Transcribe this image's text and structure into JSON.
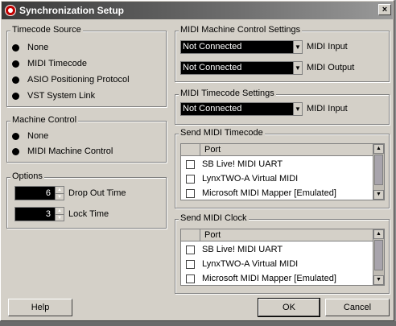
{
  "window": {
    "title": "Synchronization Setup",
    "close_glyph": "×"
  },
  "timecode_source": {
    "legend": "Timecode Source",
    "options": [
      "None",
      "MIDI Timecode",
      "ASIO Positioning Protocol",
      "VST System Link"
    ]
  },
  "machine_control": {
    "legend": "Machine Control",
    "options": [
      "None",
      "MIDI Machine Control"
    ]
  },
  "options": {
    "legend": "Options",
    "drop_out_time": {
      "value": "6",
      "label": "Drop Out Time"
    },
    "lock_time": {
      "value": "3",
      "label": "Lock Time"
    }
  },
  "mmc_settings": {
    "legend": "MIDI Machine Control Settings",
    "midi_input": {
      "value": "Not Connected",
      "label": "MIDI Input"
    },
    "midi_output": {
      "value": "Not Connected",
      "label": "MIDI Output"
    }
  },
  "mtc_settings": {
    "legend": "MIDI Timecode Settings",
    "midi_input": {
      "value": "Not Connected",
      "label": "MIDI Input"
    }
  },
  "send_mtc": {
    "legend": "Send MIDI Timecode",
    "column": "Port",
    "ports": [
      "SB Live! MIDI UART",
      "LynxTWO-A Virtual MIDI",
      "Microsoft MIDI Mapper [Emulated]"
    ]
  },
  "send_clock": {
    "legend": "Send MIDI Clock",
    "column": "Port",
    "ports": [
      "SB Live! MIDI UART",
      "LynxTWO-A Virtual MIDI",
      "Microsoft MIDI Mapper [Emulated]"
    ]
  },
  "buttons": {
    "help": "Help",
    "ok": "OK",
    "cancel": "Cancel"
  },
  "icons": {
    "dropdown": "chevron-down-icon",
    "spin_up": "up-arrow-icon",
    "spin_down": "down-arrow-icon"
  }
}
